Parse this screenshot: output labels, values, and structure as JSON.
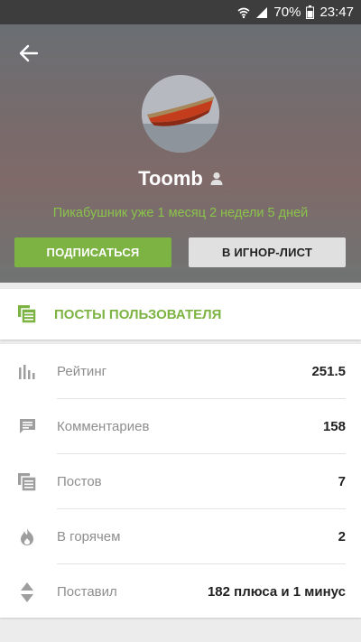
{
  "status_bar": {
    "battery": "70%",
    "time": "23:47"
  },
  "profile": {
    "username": "Toomb",
    "subtitle": "Пикабушник уже 1 месяц 2 недели 5 дней",
    "subscribe_label": "ПОДПИСАТЬСЯ",
    "ignore_label": "В ИГНОР-ЛИСТ"
  },
  "posts_link": {
    "label": "ПОСТЫ ПОЛЬЗОВАТЕЛЯ"
  },
  "stats": [
    {
      "icon": "bar-chart-icon",
      "name": "Рейтинг",
      "value": "251.5"
    },
    {
      "icon": "comment-icon",
      "name": "Комментариев",
      "value": "158"
    },
    {
      "icon": "posts-icon",
      "name": "Постов",
      "value": "7"
    },
    {
      "icon": "flame-icon",
      "name": "В горячем",
      "value": "2"
    },
    {
      "icon": "vote-arrows-icon",
      "name": "Поставил",
      "value": "182 плюса и 1 минус"
    }
  ],
  "colors": {
    "accent": "#7cb342",
    "status_bar": "#3d3d3d"
  }
}
